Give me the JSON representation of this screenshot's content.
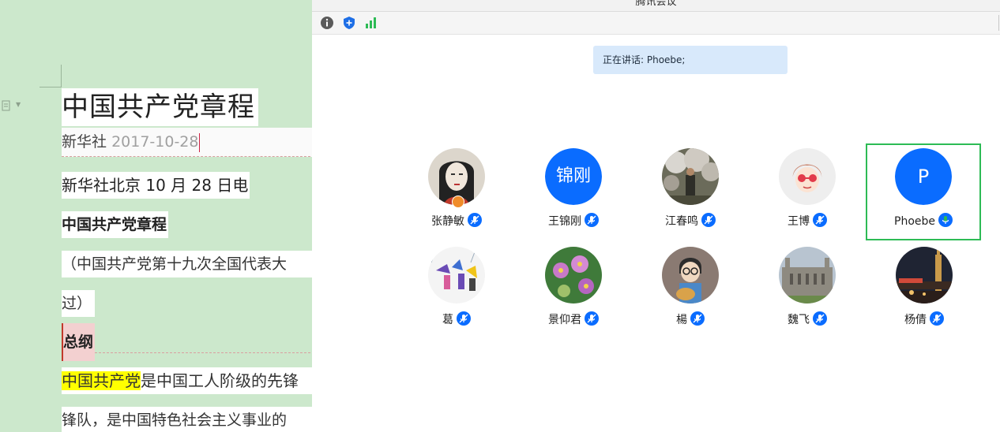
{
  "document": {
    "title": "中国共产党章程",
    "byline_source": "新华社",
    "byline_date": "2017-10-28",
    "para_dateline": "新华社北京 10 月 28 日电",
    "para_heading": "中国共产党章程",
    "para_note": "（中国共产党第十九次全国代表大",
    "para_note_end": "过）",
    "section_heading": "总纲",
    "body_highlight": "中国共产党",
    "body_rest": "是中国工人阶级的先锋",
    "body_line2": "锋队，是中国特色社会主义事业的"
  },
  "meeting": {
    "window_title": "腾讯会议",
    "speaking_label": "正在讲话: Phoebe;",
    "participants": [
      {
        "name": "张静敏",
        "avatar": "portrait-avatar",
        "mic": "mic-icon"
      },
      {
        "name": "王锦刚",
        "initials": "锦刚",
        "mic": "mic-icon"
      },
      {
        "name": "江春鸣",
        "avatar": "photo-avatar",
        "mic": "mic-icon"
      },
      {
        "name": "王博",
        "avatar": "cartoon-avatar",
        "mic": "mic-icon"
      },
      {
        "name": "Phoebe",
        "initials": "P",
        "mic": "mic-active-icon",
        "active": true
      },
      {
        "name": "葛",
        "avatar": "illustration-avatar",
        "mic": "mic-icon"
      },
      {
        "name": "景仰君",
        "avatar": "flower-avatar",
        "mic": "mic-icon"
      },
      {
        "name": "楊",
        "avatar": "guitar-avatar",
        "mic": "mic-icon"
      },
      {
        "name": "魏飞",
        "avatar": "building-avatar",
        "mic": "mic-icon"
      },
      {
        "name": "杨倩",
        "avatar": "night-city-avatar",
        "mic": "mic-icon"
      }
    ]
  },
  "colors": {
    "doc_background": "#cce8cc",
    "brand_blue": "#0a6cff",
    "active_green": "#2dbb55",
    "speaking_bg": "#d8e9fb"
  }
}
